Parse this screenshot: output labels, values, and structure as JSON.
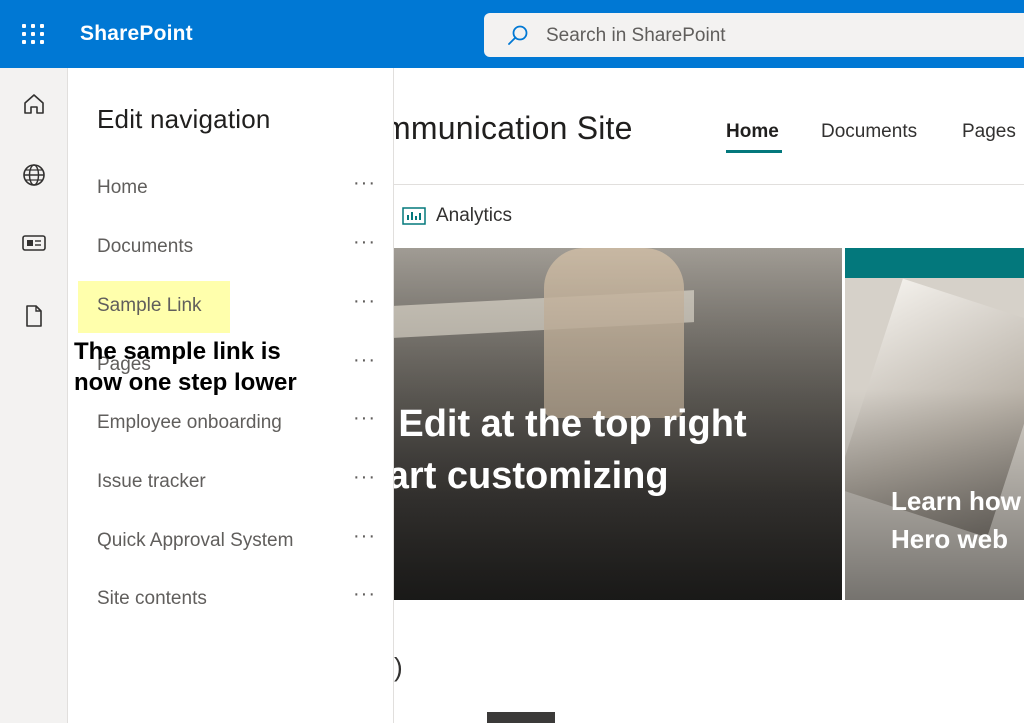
{
  "topbar": {
    "app_name": "SharePoint",
    "search_placeholder": "Search in SharePoint",
    "accent_color": "#0078d4"
  },
  "rail": {
    "icons": [
      "home-icon",
      "globe-icon",
      "news-icon",
      "document-icon"
    ]
  },
  "site": {
    "title_fragment": "mmunication Site",
    "hub_nav": [
      "Home",
      "Documents",
      "Pages"
    ],
    "analytics_label": "Analytics",
    "hero_main_line1": "ct Edit at the top right",
    "hero_main_line2": "start customizing",
    "hero_side_line1": "Learn how",
    "hero_side_line2": "Hero web",
    "bottom_fragment": ")",
    "accent_color": "#03787c"
  },
  "panel": {
    "title": "Edit navigation",
    "items": [
      {
        "label": "Home",
        "more": "···"
      },
      {
        "label": "Documents",
        "more": "···"
      },
      {
        "label": "Sample Link",
        "more": "···"
      },
      {
        "label": "Pages",
        "more": "···"
      },
      {
        "label": "Employee onboarding",
        "more": "···"
      },
      {
        "label": "Issue tracker",
        "more": "···"
      },
      {
        "label": "Quick Approval System",
        "more": "···"
      },
      {
        "label": "Site contents",
        "more": "···"
      }
    ],
    "annotation": "The sample link is now one step lower",
    "highlight_color": "#ffff9e"
  }
}
